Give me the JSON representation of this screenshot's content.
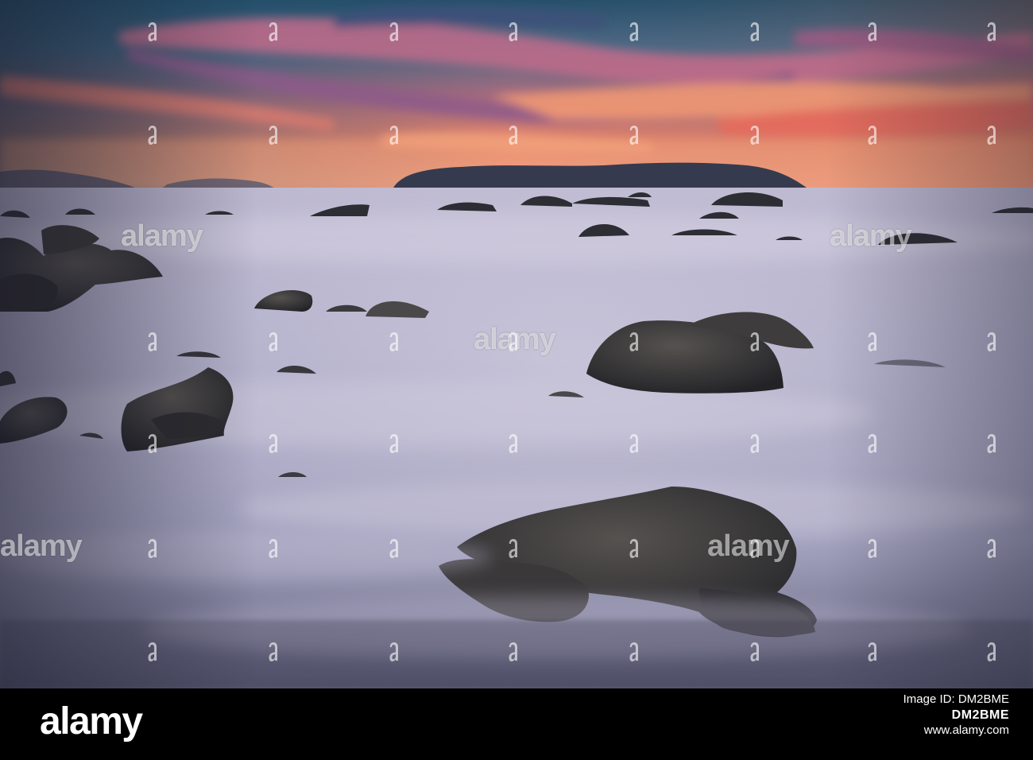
{
  "watermark": {
    "brand": "alamy"
  },
  "footer": {
    "logo": "alamy",
    "image_id_label": "Image ID: DM2BME",
    "image_code": "DM2BME",
    "site": "www.alamy.com"
  },
  "scene": {
    "subject": "long-exposure seascape at dusk",
    "colors": {
      "sky_top": "#2f5873",
      "sky_mid": "#b86a78",
      "sky_glow": "#f08a5a",
      "water": "#8f8fb0",
      "rock": "#2a2a2e"
    }
  }
}
